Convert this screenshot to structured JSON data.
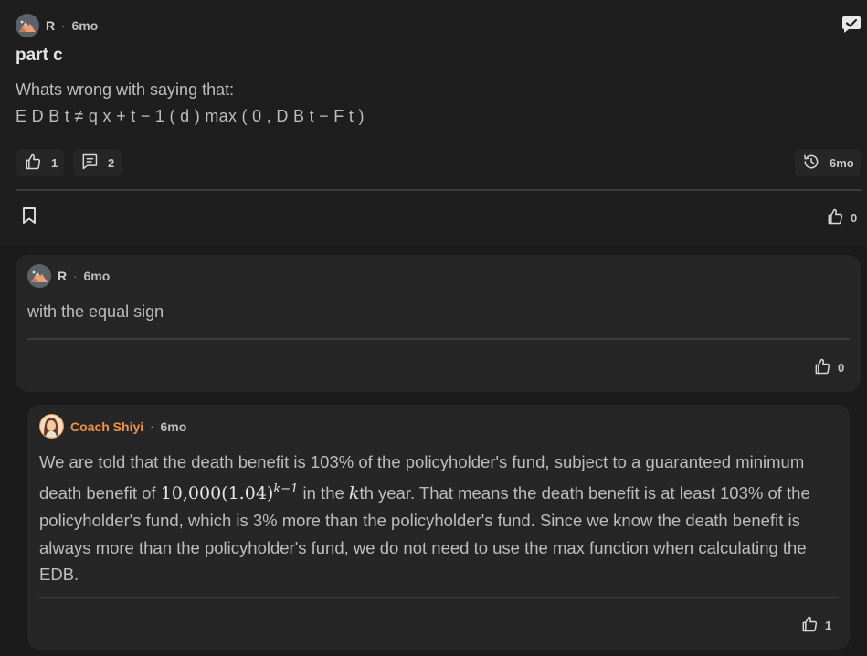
{
  "post": {
    "author": "R",
    "dot": "·",
    "time": "6mo",
    "title": "part c",
    "body_line1": "Whats wrong with saying that:",
    "body_line2": "E D B t ≠ q x + t − 1 ( d ) max ( 0 , D B t − F t )",
    "like_count": "1",
    "comment_count": "2",
    "history_time": "6mo",
    "footer_like_count": "0"
  },
  "reply": {
    "author": "R",
    "dot": "·",
    "time": "6mo",
    "text": "with the equal sign",
    "like_count": "0"
  },
  "coach_reply": {
    "author": "Coach Shiyi",
    "dot": "·",
    "time": "6mo",
    "text_part1": "We are told that the death benefit is 103% of the policyholder's fund, subject to a guaranteed minimum death benefit of ",
    "math_base": "10,000(1.04)",
    "math_exp": "k−1",
    "text_part2": " in the ",
    "math_k": "k",
    "text_part3": "th year. That means the death benefit is at least 103% of the policyholder's fund, which is 3% more than the policyholder's fund. Since we know the death benefit is always more than the policyholder's fund, we do not need to use the max function when calculating the EDB.",
    "like_count": "1",
    "name_color": "#ee9248"
  },
  "icons": {
    "avatar": "mountain-avatar-icon",
    "reply": "reply-bubble-icon",
    "like": "thumbs-up-icon",
    "comment": "comment-icon",
    "history": "history-icon",
    "bookmark": "bookmark-icon"
  }
}
